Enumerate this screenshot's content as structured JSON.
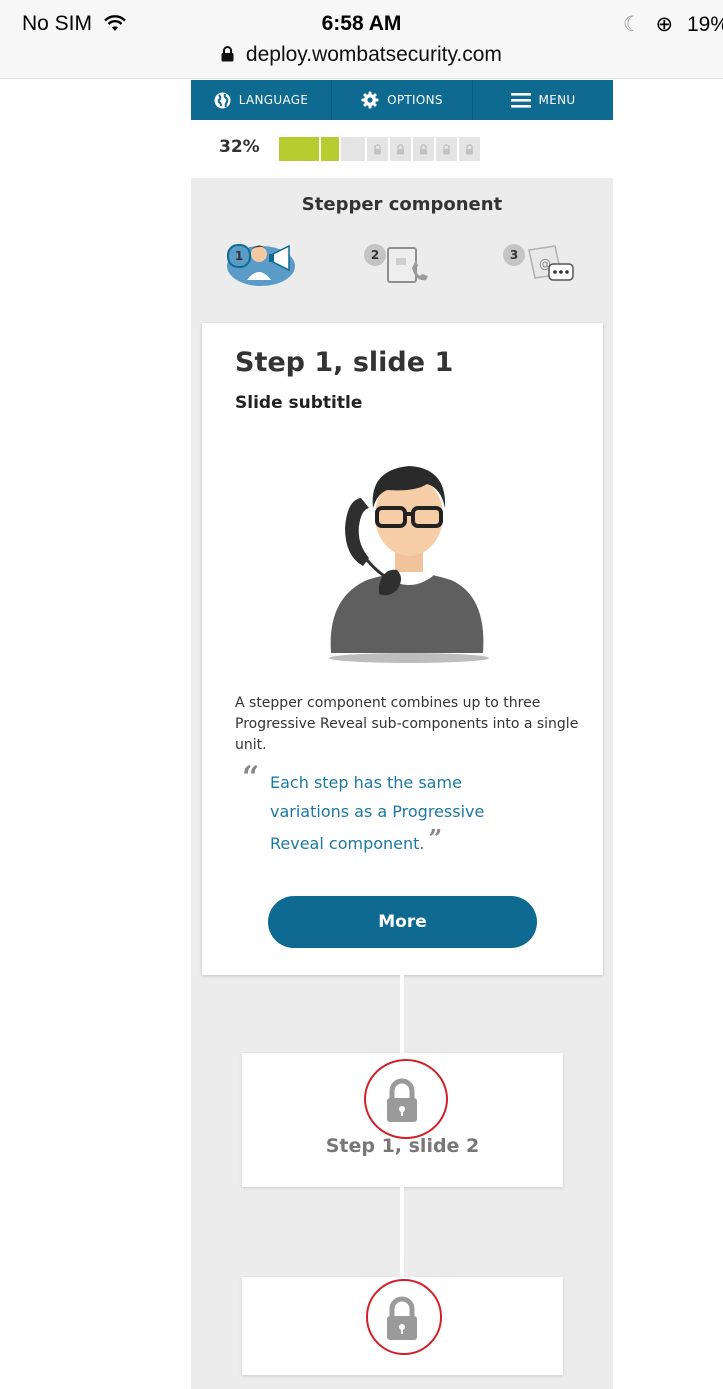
{
  "status_bar": {
    "carrier": "No SIM",
    "time": "6:58 AM",
    "battery": "19%"
  },
  "browser": {
    "url": "deploy.wombatsecurity.com"
  },
  "nav": {
    "language": "LANGUAGE",
    "options": "OPTIONS",
    "menu": "MENU"
  },
  "progress": {
    "percent_label": "32%",
    "value": 0.32,
    "segments_total": 11,
    "segments_done": 2
  },
  "stepper": {
    "title": "Stepper component",
    "steps": [
      {
        "number": "1",
        "icon": "person-megaphone-icon",
        "active": true
      },
      {
        "number": "2",
        "icon": "tablet-phone-icon",
        "active": false
      },
      {
        "number": "3",
        "icon": "email-chat-icon",
        "active": false
      }
    ]
  },
  "slide": {
    "title": "Step 1, slide 1",
    "subtitle": "Slide subtitle",
    "body": "A stepper component combines up to three Progressive Reveal sub-components into a single unit.",
    "quote": "Each step has the same variations as a Progressive Reveal component.",
    "button_label": "More"
  },
  "locked_slides": [
    {
      "title": "Step 1, slide 2"
    },
    {
      "title": ""
    }
  ],
  "colors": {
    "brand_blue": "#0f6a92",
    "progress_green": "#b7cc2e",
    "quote_blue": "#1c7aa0",
    "annotation_red": "#d0202a"
  }
}
